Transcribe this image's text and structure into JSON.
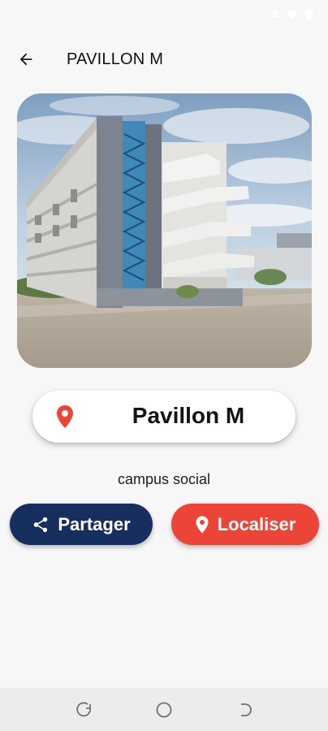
{
  "status_bar": {
    "time": ""
  },
  "app_bar": {
    "title": "PAVILLON M",
    "back_icon": "arrow-left-icon"
  },
  "photo": {
    "alt": "Pavillon M building"
  },
  "place": {
    "name": "Pavillon M",
    "pin_icon": "location-pin-icon",
    "category": "campus social"
  },
  "actions": {
    "share": {
      "label": "Partager",
      "icon": "share-icon",
      "color": "#172f5e"
    },
    "locate": {
      "label": "Localiser",
      "icon": "location-pin-icon",
      "color": "#ec4436"
    }
  },
  "colors": {
    "accent_red": "#ec4436",
    "navy": "#172f5e",
    "background": "#f7f7f7"
  },
  "nav": {
    "recents_icon": "recents-icon",
    "home_icon": "home-icon",
    "back_icon": "back-icon"
  }
}
